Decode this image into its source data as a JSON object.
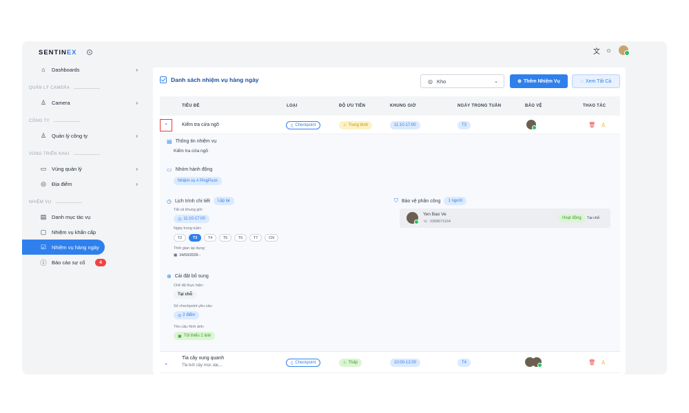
{
  "brand": {
    "name_a": "SENTIN",
    "name_b": "EX"
  },
  "sidebar": {
    "dashboards": "Dashboards",
    "sec_camera": "QUẢN LÝ CAMERA",
    "camera": "Camera",
    "sec_company": "CÔNG TY",
    "company": "Quản lý công ty",
    "sec_deploy": "VÙNG TRIỂN KHAI",
    "zone": "Vùng quản lý",
    "location": "Địa điểm",
    "sec_task": "NHIỆM VỤ",
    "task_catalog": "Danh mục tác vụ",
    "urgent": "Nhiệm vụ khẩn cấp",
    "daily": "Nhiệm vụ hàng ngày",
    "incident": "Báo cáo sự cố",
    "incident_count": "4"
  },
  "header": {
    "title": "Danh sách nhiệm vụ hàng ngày",
    "select_value": "Kho",
    "add_button": "Thêm Nhiệm Vụ",
    "view_all": "Xem Tất Cả"
  },
  "table": {
    "columns": [
      "TIÊU ĐỀ",
      "LOẠI",
      "ĐỘ ƯU TIÊN",
      "KHUNG GIỜ",
      "NGÀY TRONG TUẦN",
      "BẢO VỆ",
      "THAO TÁC"
    ],
    "rows": [
      {
        "title": "Kiểm tra cửa ngõ",
        "subtitle": "",
        "type": "Checkpoint",
        "priority": "Trung bình",
        "time": "11:10-17:00",
        "day": "T3"
      },
      {
        "title": "Tỉa cây xung quanh",
        "subtitle": "Tỉa bớt cây mọc dại,...",
        "type": "Checkpoint",
        "priority": "Thấp",
        "time": "10:00-12:00",
        "day": "T4"
      }
    ]
  },
  "detail": {
    "info_head": "Thông tin nhiệm vụ",
    "info_text": "Kiểm tra cửa ngõ",
    "group_head": "Nhóm hành động",
    "group_tag": "Nhiệm vụ # PingPush",
    "schedule_head": "Lịch trình chi tiết",
    "schedule_tag": "Lặp lại",
    "slots_label": "Tất cả khung giờ:",
    "slot": "11:10-17:00",
    "days_label": "Ngày trong tuần:",
    "days": [
      "T2",
      "T3",
      "T4",
      "T5",
      "T6",
      "T7",
      "CN"
    ],
    "apply_label": "Thời gian áp dụng:",
    "apply_value": "24/03/2026 -",
    "extra_head": "Cài đặt bổ sung",
    "mode_label": "Chế độ thực hiện:",
    "mode_value": "Tại chỗ",
    "cp_label": "Số checkpoint yêu cầu:",
    "cp_value": "2 điểm",
    "img_label": "Yêu cầu hình ảnh:",
    "img_value": "Tối thiểu 2 ảnh",
    "guard_head": "Bảo vệ phân công",
    "guard_count": "1 người",
    "guard_name": "Yen Bao Ve",
    "guard_phone": "0368671164",
    "guard_status": "Hoạt động",
    "guard_mode": "Tại chỗ"
  },
  "colors": {
    "accent": "#2f80ed",
    "danger": "#ef4444",
    "warning": "#f59e0b"
  }
}
